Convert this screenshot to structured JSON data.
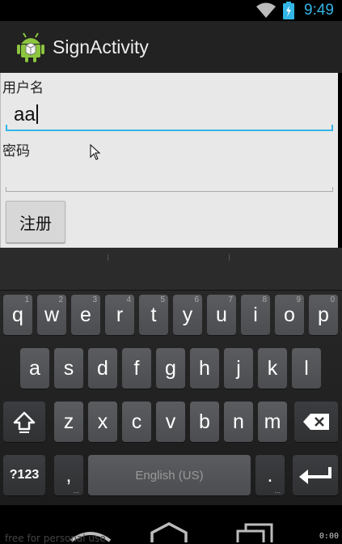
{
  "status_bar": {
    "time": "9:49",
    "icons": [
      "wifi-icon",
      "battery-charging-icon"
    ]
  },
  "action_bar": {
    "title": "SignActivity",
    "icon": "android-logo-icon"
  },
  "form": {
    "username_label": "用户名",
    "username_value": "aa",
    "password_label": "密码",
    "password_value": "",
    "signup_button": "注册"
  },
  "keyboard": {
    "row1": [
      {
        "key": "q",
        "hint": "1"
      },
      {
        "key": "w",
        "hint": "2"
      },
      {
        "key": "e",
        "hint": "3"
      },
      {
        "key": "r",
        "hint": "4"
      },
      {
        "key": "t",
        "hint": "5"
      },
      {
        "key": "y",
        "hint": "6"
      },
      {
        "key": "u",
        "hint": "7"
      },
      {
        "key": "i",
        "hint": "8"
      },
      {
        "key": "o",
        "hint": "9"
      },
      {
        "key": "p",
        "hint": "0"
      }
    ],
    "row2": [
      "a",
      "s",
      "d",
      "f",
      "g",
      "h",
      "j",
      "k",
      "l"
    ],
    "row3": [
      "z",
      "x",
      "c",
      "v",
      "b",
      "n",
      "m"
    ],
    "symbols_key": "?123",
    "comma_key": ",",
    "space_key": "English (US)",
    "period_key": ".",
    "shift_icon": "shift-icon",
    "delete_icon": "backspace-icon",
    "enter_icon": "enter-icon"
  },
  "nav_bar": {
    "buttons": [
      "back-icon",
      "home-icon",
      "recents-icon"
    ],
    "watermark": "free for personal use",
    "fps": "0:00"
  },
  "colors": {
    "accent": "#33b5e5",
    "content_bg": "#e8e8e8",
    "action_bar": "#222222"
  }
}
